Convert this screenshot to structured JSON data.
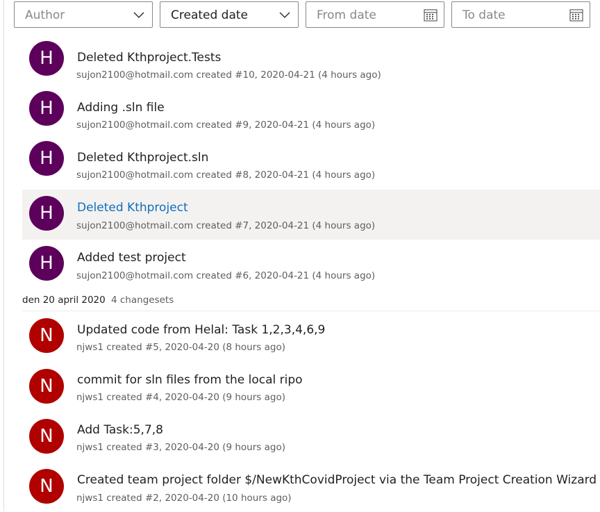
{
  "filters": {
    "author": {
      "placeholder": "Author",
      "icon": "chevron-down-icon"
    },
    "created_date": {
      "value": "Created date",
      "icon": "chevron-down-icon"
    },
    "from_date": {
      "placeholder": "From date",
      "icon": "calendar-icon"
    },
    "to_date": {
      "placeholder": "To date",
      "icon": "calendar-icon"
    }
  },
  "changesets_top": [
    {
      "initial": "H",
      "title": "Deleted Kthproject.Tests",
      "meta": "sujon2100@hotmail.com created #10, 2020-04-21 (4 hours ago)"
    },
    {
      "initial": "H",
      "title": "Adding .sln file",
      "meta": "sujon2100@hotmail.com created #9, 2020-04-21 (4 hours ago)"
    },
    {
      "initial": "H",
      "title": "Deleted Kthproject.sln",
      "meta": "sujon2100@hotmail.com created #8, 2020-04-21 (4 hours ago)"
    },
    {
      "initial": "H",
      "title": "Deleted Kthproject",
      "meta": "sujon2100@hotmail.com created #7, 2020-04-21 (4 hours ago)"
    },
    {
      "initial": "H",
      "title": "Added test project",
      "meta": "sujon2100@hotmail.com created #6, 2020-04-21 (4 hours ago)"
    }
  ],
  "group": {
    "date": "den 20 april 2020",
    "count": "4 changesets"
  },
  "changesets_bottom": [
    {
      "initial": "N",
      "title": "Updated code from Helal: Task 1,2,3,4,6,9",
      "meta": "njws1 created #5, 2020-04-20 (8 hours ago)"
    },
    {
      "initial": "N",
      "title": "commit for sln files from the local ripo",
      "meta": "njws1 created #4, 2020-04-20 (9 hours ago)"
    },
    {
      "initial": "N",
      "title": "Add Task:5,7,8",
      "meta": "njws1 created #3, 2020-04-20 (9 hours ago)"
    },
    {
      "initial": "N",
      "title": "Created team project folder $/NewKthCovidProject via the Team Project Creation Wizard",
      "meta": "njws1 created #2, 2020-04-20 (10 hours ago)"
    }
  ],
  "colors": {
    "avatar_h": "#5c005c",
    "avatar_n": "#b00000",
    "link_hover": "#106ebe"
  }
}
